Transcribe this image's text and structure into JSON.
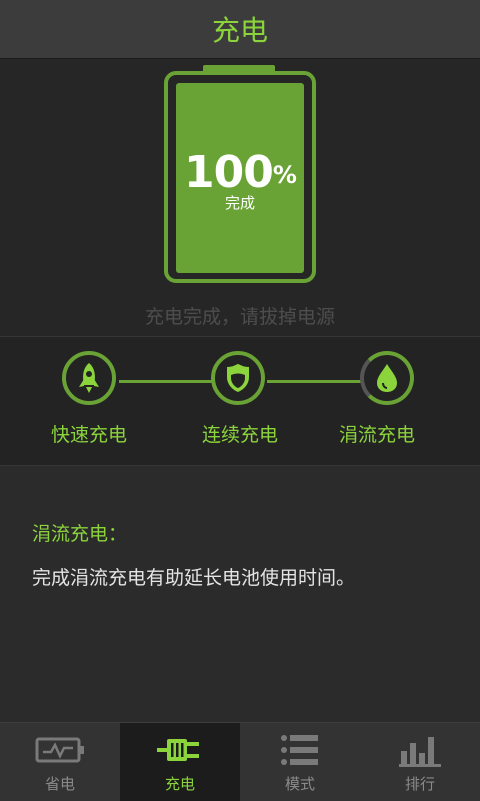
{
  "header": {
    "title": "充电"
  },
  "battery": {
    "percent": "100",
    "percent_sign": "%",
    "state_label": "完成",
    "level": 1.0
  },
  "status_text": "充电完成，请拔掉电源",
  "modes": [
    {
      "label": "快速充电",
      "icon": "rocket-icon"
    },
    {
      "label": "连续充电",
      "icon": "shield-icon"
    },
    {
      "label": "涓流充电",
      "icon": "water-drop-icon",
      "active": true
    }
  ],
  "info": {
    "title": "涓流充电：",
    "body": "完成涓流充电有助延长电池使用时间。"
  },
  "tabs": [
    {
      "label": "省电",
      "icon": "battery-pulse-icon"
    },
    {
      "label": "充电",
      "icon": "plug-icon",
      "selected": true
    },
    {
      "label": "模式",
      "icon": "list-icon"
    },
    {
      "label": "排行",
      "icon": "bar-chart-icon"
    }
  ],
  "colors": {
    "accent": "#8bd43c",
    "battery_green": "#6aa335",
    "background": "#2b2b2b"
  }
}
